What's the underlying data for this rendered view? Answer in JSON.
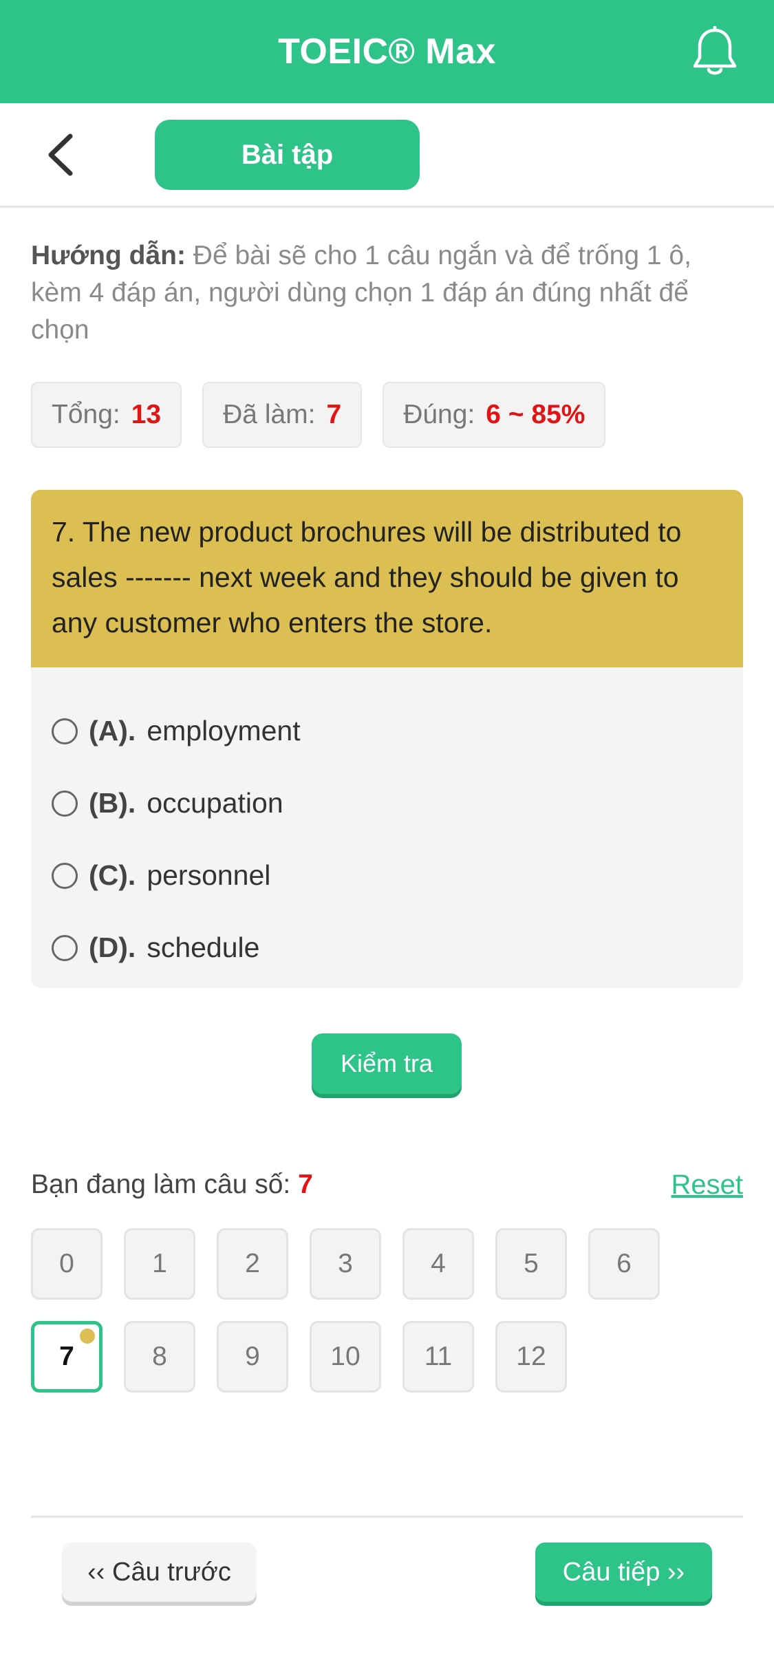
{
  "header": {
    "title": "TOEIC® Max",
    "bell_icon": "bell-icon"
  },
  "subheader": {
    "back_icon": "chevron-left-icon",
    "tab_label": "Bài tập"
  },
  "guide": {
    "label": "Hướng dẫn:",
    "text": " Để bài sẽ cho 1 câu ngắn và để trống 1 ô, kèm 4 đáp án, người dùng chọn 1 đáp án đúng nhất để chọn"
  },
  "stats": [
    {
      "label": "Tổng:",
      "value": "13"
    },
    {
      "label": "Đã làm:",
      "value": "7"
    },
    {
      "label": "Đúng:",
      "value": "6 ~ 85%"
    }
  ],
  "question": {
    "text": "7. The new product brochures will be distributed to sales ------- next week and they should be given to any customer who enters the store.",
    "options": [
      {
        "label": "(A).",
        "text": "employment"
      },
      {
        "label": "(B).",
        "text": "occupation"
      },
      {
        "label": "(C).",
        "text": "personnel"
      },
      {
        "label": "(D).",
        "text": "schedule"
      }
    ]
  },
  "check_button": "Kiểm tra",
  "progress": {
    "label": "Bạn đang làm câu số:",
    "current": "7",
    "reset": "Reset"
  },
  "grid": [
    "0",
    "1",
    "2",
    "3",
    "4",
    "5",
    "6",
    "7",
    "8",
    "9",
    "10",
    "11",
    "12"
  ],
  "active_index": 7,
  "nav": {
    "prev": "‹‹ Câu trước",
    "next": "Câu tiếp ››"
  },
  "colors": {
    "primary": "#2ec489",
    "question_bg": "#dbbf52",
    "highlight": "#e01414"
  }
}
